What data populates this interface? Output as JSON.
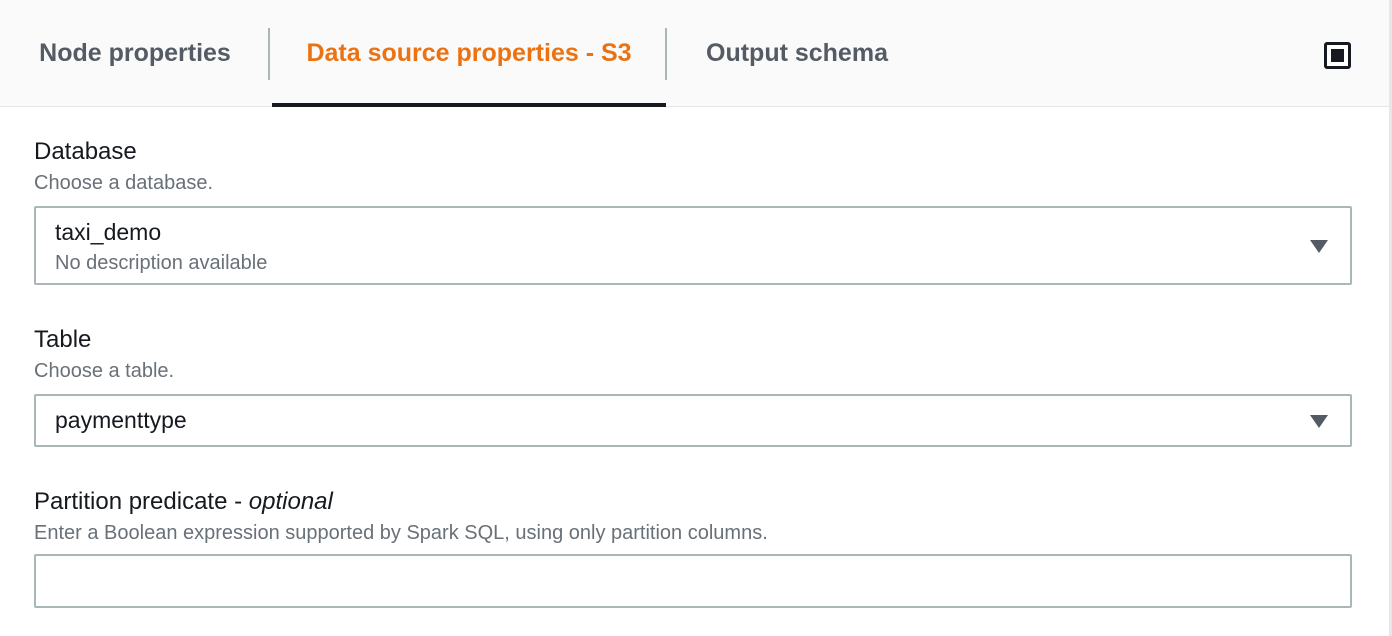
{
  "tabs": [
    {
      "label": "Node properties",
      "active": false
    },
    {
      "label": "Data source properties - S3",
      "active": true
    },
    {
      "label": "Output schema",
      "active": false
    }
  ],
  "colors": {
    "active_tab": "#ec7211",
    "text": "#16191f",
    "muted": "#687078",
    "border": "#aab7b8"
  },
  "icons": {
    "expand": "square-expand-icon",
    "caret": "caret-down-icon"
  },
  "database": {
    "label": "Database",
    "description": "Choose a database.",
    "value": "taxi_demo",
    "value_description": "No description available"
  },
  "table": {
    "label": "Table",
    "description": "Choose a table.",
    "value": "paymenttype"
  },
  "partition": {
    "label": "Partition predicate - ",
    "label_optional": "optional",
    "description": "Enter a Boolean expression supported by Spark SQL, using only partition columns.",
    "value": "",
    "placeholder": ""
  }
}
